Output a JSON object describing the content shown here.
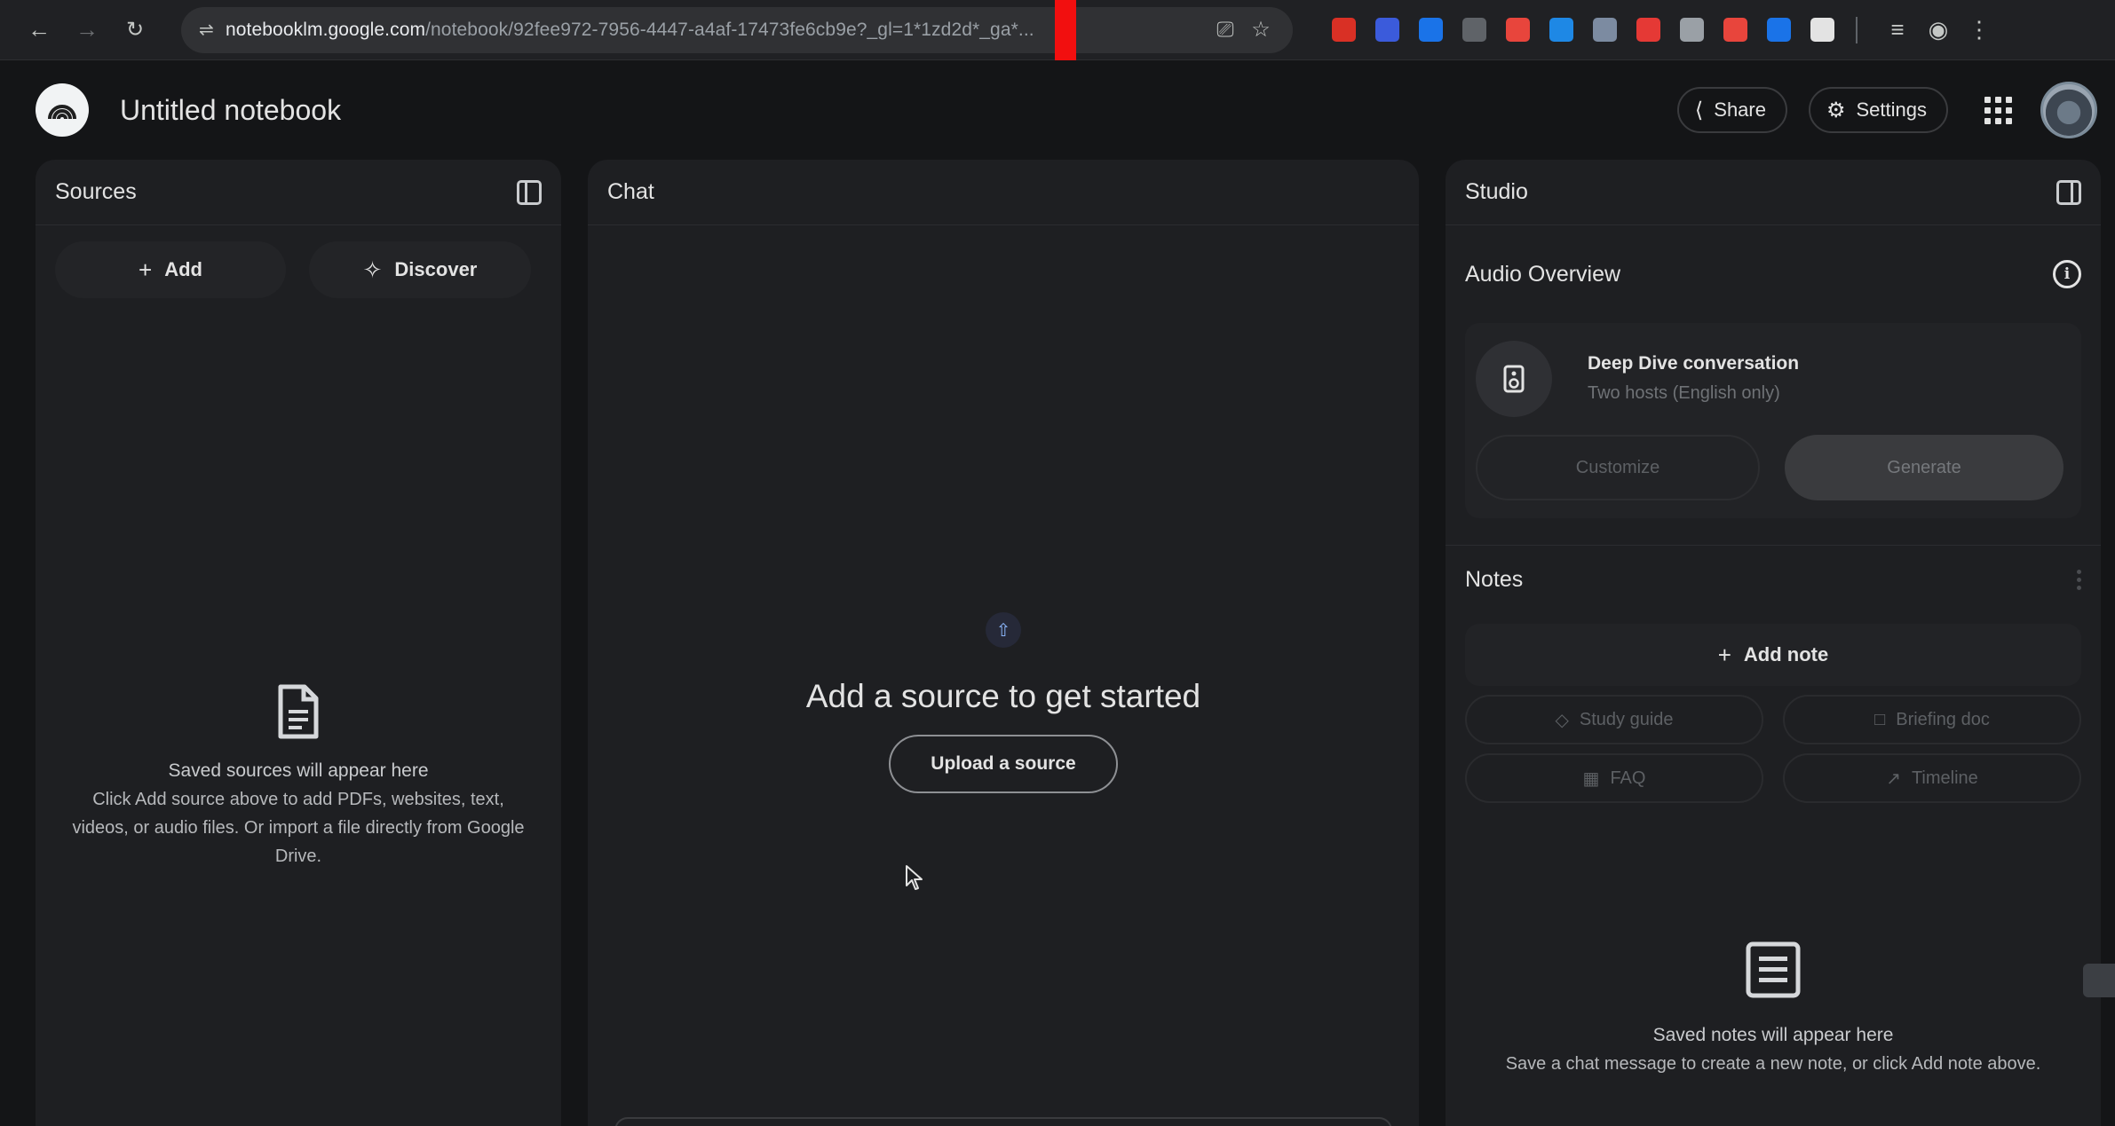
{
  "browser": {
    "url_host": "notebooklm.google.com",
    "url_path": "/notebook/92fee972-7956-4447-a4af-17473fe6cb9e?_gl=1*1",
    "url_tail": "zd2d*_ga*...",
    "extension_colors": [
      "#d93025",
      "#3b5bdb",
      "#1a73e8",
      "#5f6368",
      "#e8453c",
      "#1e88e5",
      "#7c8ba1",
      "#e53935",
      "#9aa0a6",
      "#e8453c",
      "#1a73e8",
      "#e3e3e3"
    ]
  },
  "header": {
    "title": "Untitled notebook",
    "share_label": "Share",
    "settings_label": "Settings"
  },
  "sources": {
    "title": "Sources",
    "add_label": "Add",
    "discover_label": "Discover",
    "empty_title": "Saved sources will appear here",
    "empty_text": "Click Add source above to add PDFs, websites, text, videos, or audio files. Or import a file directly from Google Drive."
  },
  "chat": {
    "title": "Chat",
    "empty_title": "Add a source to get started",
    "upload_label": "Upload a source"
  },
  "studio": {
    "title": "Studio",
    "audio_title": "Audio Overview",
    "audio_name": "Deep Dive conversation",
    "audio_sub": "Two hosts (English only)",
    "customize_label": "Customize",
    "generate_label": "Generate",
    "notes_title": "Notes",
    "add_note_label": "Add note",
    "chips": [
      {
        "icon": "graduation-cap-icon",
        "label": "Study guide"
      },
      {
        "icon": "briefing-doc-icon",
        "label": "Briefing doc"
      },
      {
        "icon": "faq-icon",
        "label": "FAQ"
      },
      {
        "icon": "timeline-icon",
        "label": "Timeline"
      }
    ],
    "notes_empty_title": "Saved notes will appear here",
    "notes_empty_text": "Save a chat message to create a new note, or click Add note above."
  }
}
